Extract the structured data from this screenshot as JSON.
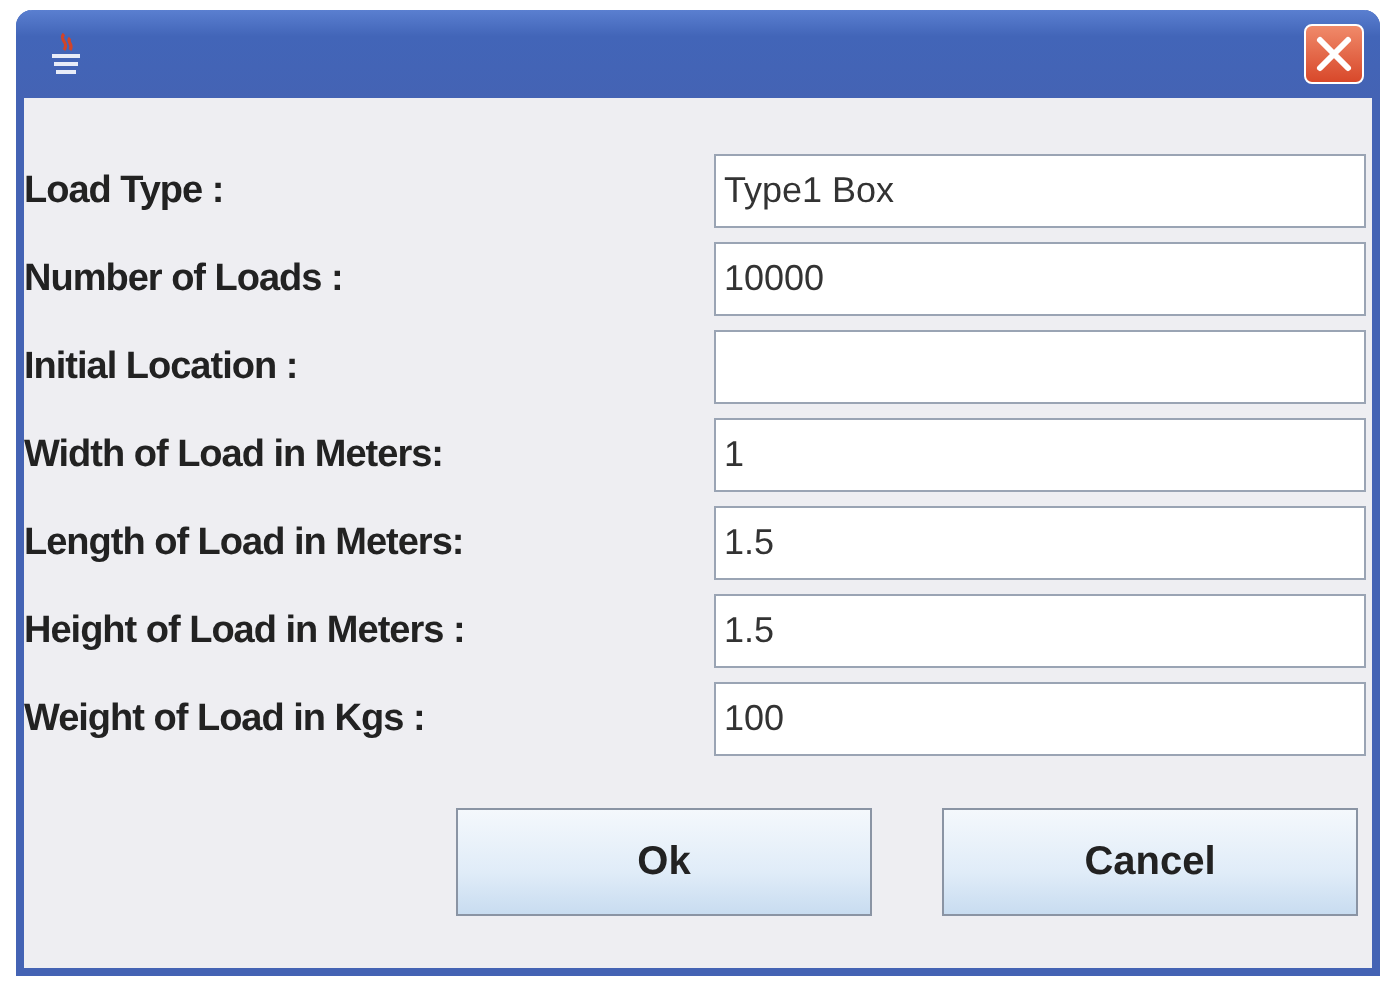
{
  "fields": [
    {
      "label": "Load Type :",
      "value": "Type1 Box"
    },
    {
      "label": "Number of Loads :",
      "value": "10000"
    },
    {
      "label": "Initial Location :"
    },
    {
      "label": "Width of Load in Meters:",
      "value": "1"
    },
    {
      "label": "Length of Load in Meters:",
      "value": "1.5"
    },
    {
      "label": "Height of Load in Meters :",
      "value": "1.5"
    },
    {
      "label": "Weight of Load in Kgs :",
      "value": "100"
    }
  ],
  "buttons": [
    "Ok",
    "Cancel"
  ]
}
